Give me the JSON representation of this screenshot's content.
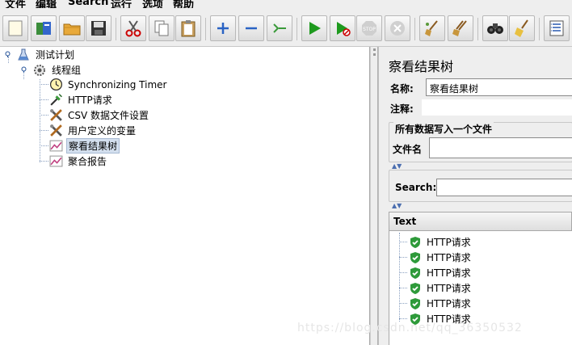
{
  "menu": [
    "文件",
    "编辑",
    "Search",
    "运行",
    "选项",
    "帮助"
  ],
  "toolbar_icons": [
    "new-icon",
    "templates-icon",
    "open-icon",
    "save-icon",
    "cut-icon",
    "copy-icon",
    "paste-icon",
    "expand-icon",
    "collapse-icon",
    "toggle-icon",
    "start-icon",
    "start-no-pause-icon",
    "stop-icon",
    "shutdown-icon",
    "clear-icon",
    "clear-all-icon",
    "search-icon",
    "reset-search-icon",
    "function-helper-icon"
  ],
  "tree": {
    "test_plan": "测试计划",
    "thread_group": "线程组",
    "children": [
      {
        "label": "Synchronizing Timer",
        "icon": "timer-icon"
      },
      {
        "label": "HTTP请求",
        "icon": "sampler-icon"
      },
      {
        "label": "CSV 数据文件设置",
        "icon": "config-tools-icon"
      },
      {
        "label": "用户定义的变量",
        "icon": "config-tools-icon"
      },
      {
        "label": "察看结果树",
        "icon": "listener-icon",
        "selected": true
      },
      {
        "label": "聚合报告",
        "icon": "listener-icon"
      }
    ]
  },
  "panel": {
    "title": "察看结果树",
    "name_label": "名称:",
    "name_value": "察看结果树",
    "comment_label": "注释:",
    "comment_value": "",
    "fieldset_title": "所有数据写入一个文件",
    "filename_label": "文件名",
    "filename_value": "",
    "search_label": "Search:",
    "search_value": "",
    "table_header": "Text",
    "results": [
      "HTTP请求",
      "HTTP请求",
      "HTTP请求",
      "HTTP请求",
      "HTTP请求",
      "HTTP请求"
    ]
  },
  "watermark": "https://blog.csdn.net/qq_36350532"
}
